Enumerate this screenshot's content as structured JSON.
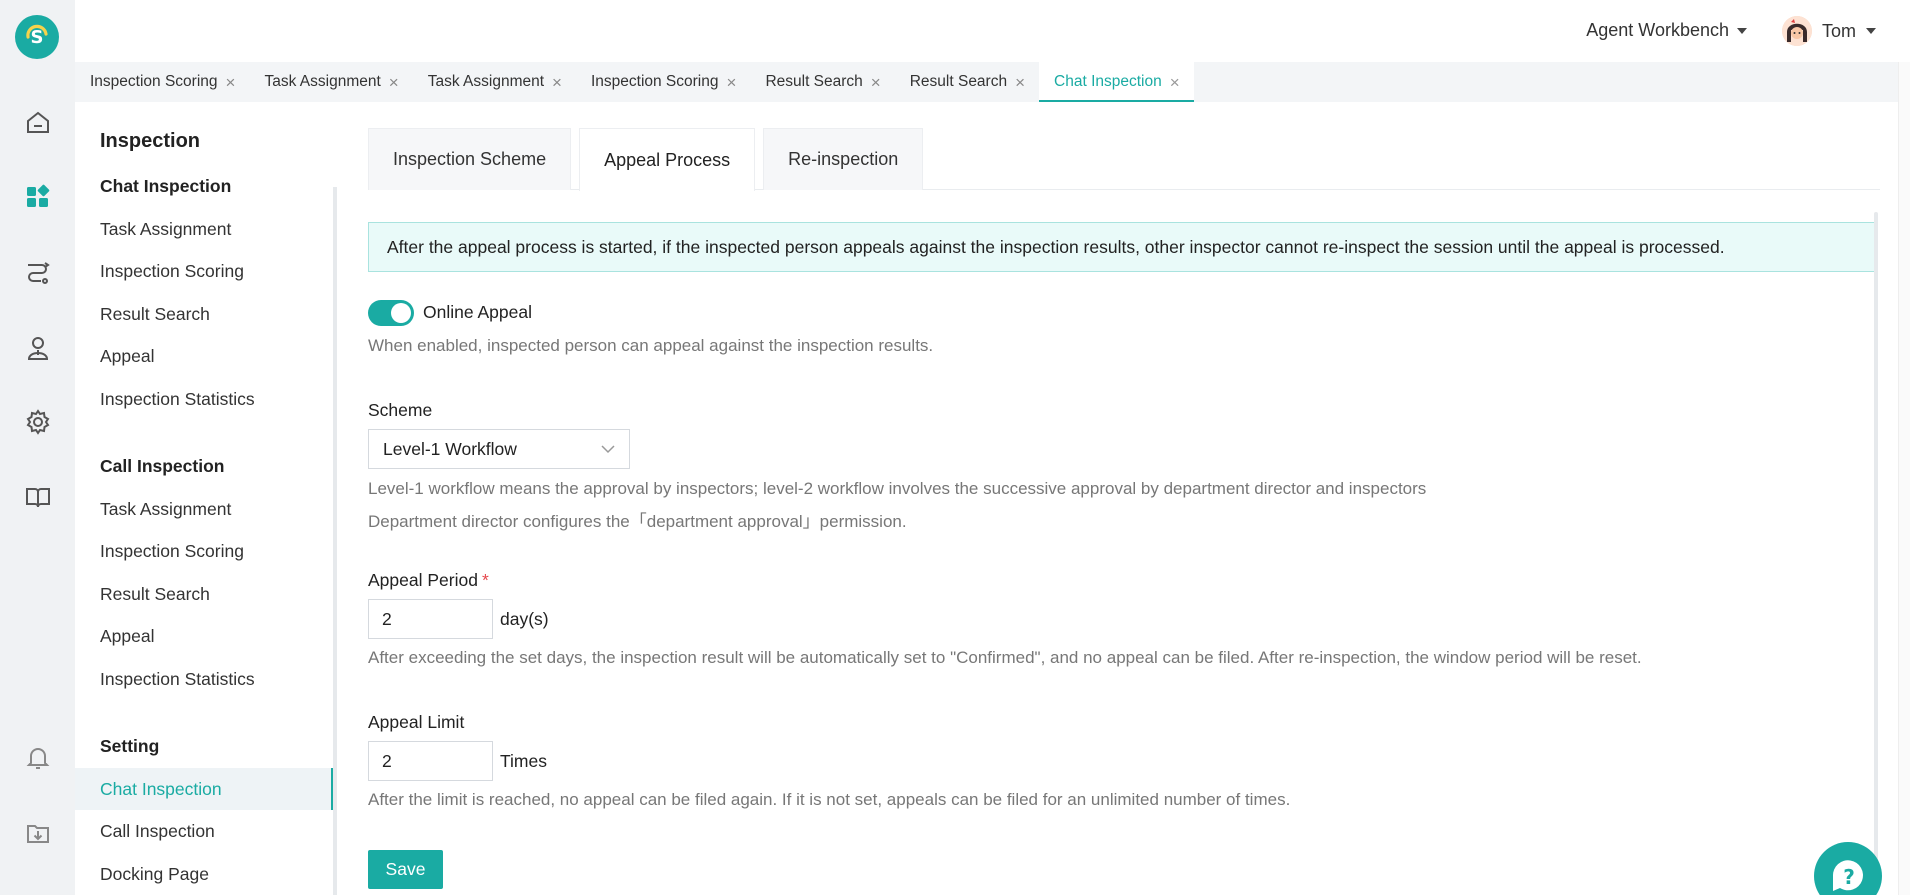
{
  "rail": {
    "logo_letter": "S",
    "icons": [
      "home-icon",
      "apps-icon",
      "route-icon",
      "agent-icon",
      "gear-icon",
      "book-icon",
      "bell-icon",
      "download-icon"
    ]
  },
  "header": {
    "workbench_label": "Agent Workbench",
    "user_name": "Tom"
  },
  "page_tabs": [
    {
      "label": "Inspection Scoring"
    },
    {
      "label": "Task Assignment"
    },
    {
      "label": "Task Assignment"
    },
    {
      "label": "Inspection Scoring"
    },
    {
      "label": "Result Search"
    },
    {
      "label": "Result Search"
    },
    {
      "label": "Chat Inspection",
      "active": true
    }
  ],
  "sidebar": {
    "title": "Inspection",
    "sections": [
      {
        "heading": "Chat Inspection",
        "items": [
          "Task Assignment",
          "Inspection Scoring",
          "Result Search",
          "Appeal",
          "Inspection Statistics"
        ]
      },
      {
        "heading": "Call Inspection",
        "items": [
          "Task Assignment",
          "Inspection Scoring",
          "Result Search",
          "Appeal",
          "Inspection Statistics"
        ]
      },
      {
        "heading": "Setting",
        "items": [
          "Chat Inspection",
          "Call Inspection",
          "Docking Page"
        ]
      }
    ]
  },
  "content_tabs": [
    "Inspection Scheme",
    "Appeal Process",
    "Re-inspection"
  ],
  "notice": "After the appeal process is started, if the inspected person appeals against the inspection results, other inspector cannot re-inspect the session until the appeal is processed.",
  "online_appeal": {
    "label": "Online Appeal",
    "enabled": true,
    "help": "When enabled, inspected person can appeal against the inspection results."
  },
  "scheme": {
    "label": "Scheme",
    "value": "Level-1 Workflow",
    "help1": "Level-1 workflow means the approval by inspectors; level-2 workflow involves the successive approval by department director and inspectors",
    "help2": "Department director configures the「department approval」permission."
  },
  "appeal_period": {
    "label": "Appeal Period",
    "required_mark": "*",
    "value": "2",
    "unit": "day(s)",
    "help": "After exceeding the set days, the inspection result will be automatically set to \"Confirmed\", and no appeal can be filed. After re-inspection, the window period will be reset."
  },
  "appeal_limit": {
    "label": "Appeal Limit",
    "value": "2",
    "unit": "Times",
    "help": "After the limit is reached, no appeal can be filed again. If it is not set, appeals can be filed for an unlimited number of times."
  },
  "save_label": "Save",
  "colors": {
    "accent": "#1aaba3",
    "notice_bg": "#e9faf9",
    "required": "#e5484d"
  }
}
